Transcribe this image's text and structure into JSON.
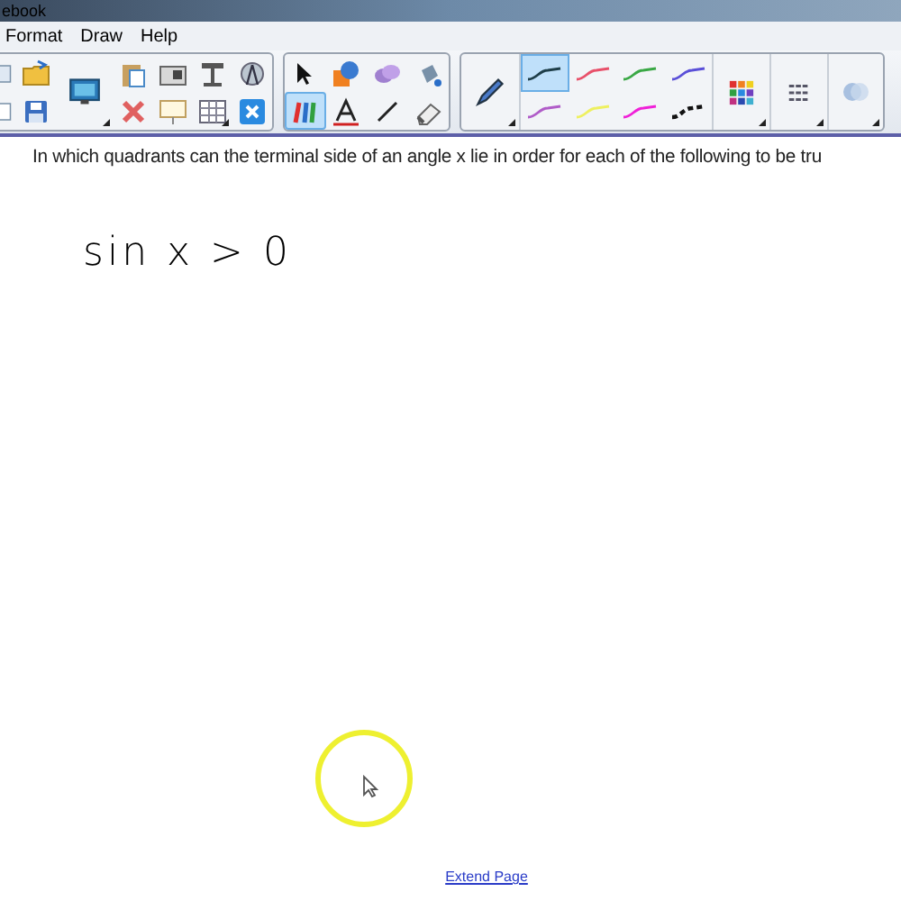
{
  "window": {
    "title": "ebook"
  },
  "menu": [
    {
      "label": "Format"
    },
    {
      "label": "Draw"
    },
    {
      "label": "Help"
    }
  ],
  "toolbar": {
    "tools": [
      {
        "selected": false
      },
      {
        "selected": false
      },
      {
        "selected": false
      },
      {
        "selected": false
      },
      {
        "selected": true
      },
      {
        "selected": false
      },
      {
        "selected": false
      },
      {
        "selected": false
      }
    ],
    "pen_styles": [
      {
        "kind": "solid",
        "color": "#1f3f4a",
        "selected": true
      },
      {
        "kind": "solid",
        "color": "#e8506a",
        "selected": false
      },
      {
        "kind": "solid",
        "color": "#3aa845",
        "selected": false
      },
      {
        "kind": "solid",
        "color": "#5a4fd8",
        "selected": false
      },
      {
        "kind": "solid",
        "color": "#b05cc8",
        "selected": false
      },
      {
        "kind": "solid",
        "color": "#eef060",
        "selected": false
      },
      {
        "kind": "solid",
        "color": "#f020d8",
        "selected": false
      },
      {
        "kind": "dashed",
        "color": "#111111",
        "selected": false
      }
    ]
  },
  "page": {
    "question": "In which quadrants can the terminal side of an angle x lie in order for each of the following to be tru",
    "ink": "sin x > 0",
    "link": "Extend Page"
  }
}
